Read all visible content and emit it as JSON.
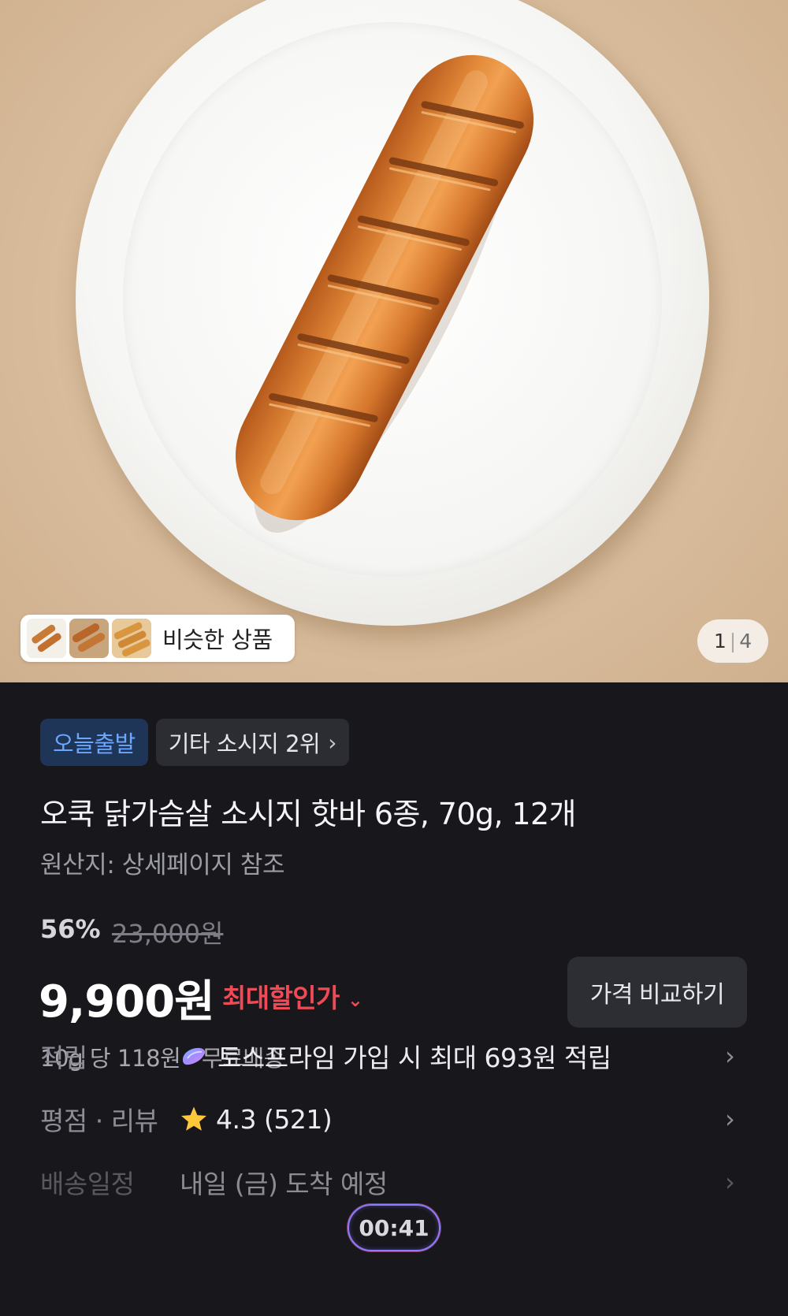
{
  "hero": {
    "similar_label": "비슷한 상품",
    "counter_current": "1",
    "counter_separator": "|",
    "counter_total": "4"
  },
  "badges": {
    "delivery": "오늘출발",
    "ranking": "기타 소시지 2위"
  },
  "product": {
    "title": "오쿡 닭가슴살 소시지 핫바 6종, 70g, 12개",
    "origin": "원산지: 상세페이지 참조"
  },
  "pricing": {
    "discount": "56%",
    "original_price": "23,000원",
    "price": "9,900원",
    "max_discount_label": "최대할인가",
    "compare_button": "가격 비교하기",
    "unit_price": "10g 당 118원 · 무료배송"
  },
  "rows": [
    {
      "label": "적립",
      "value": "토스프라임 가입 시 최대 693원 적립",
      "icon": "toss-prime-icon"
    },
    {
      "label": "평점 · 리뷰",
      "value": "4.3 (521)",
      "icon": "star-icon"
    },
    {
      "label": "배송일정",
      "value": "내일 (금) 도착 예정",
      "icon": ""
    }
  ],
  "timer": "00:41",
  "colors": {
    "background": "#18181c",
    "accent_red": "#ef4a56",
    "accent_blue": "#6aa7ff",
    "star": "#ffc83a"
  }
}
